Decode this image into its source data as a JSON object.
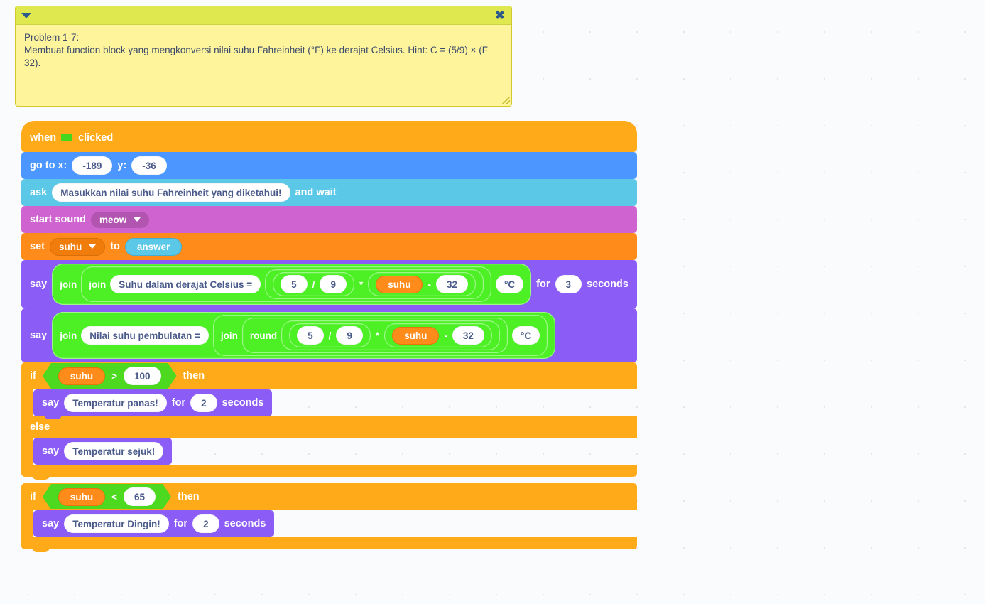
{
  "comment": {
    "collapse_icon": "triangle-down-icon",
    "close_icon": "close-icon",
    "text": "Problem 1-7:\nMembuat function block yang mengkonversi nilai suhu Fahreinheit (°F) ke derajat Celsius. Hint: C = (5/9) × (F − 32)."
  },
  "colors": {
    "events": "#ffab19",
    "motion": "#4c97ff",
    "sensing": "#5cc8e8",
    "sound": "#cf63cf",
    "variables": "#ff8c1a",
    "looks": "#8b5cf6",
    "control": "#ffab19",
    "operators": "#4cf024",
    "boolean": "#4cd91f",
    "comment_body": "#fef49c",
    "comment_bar": "#dfe84f",
    "canvas": "#fafbfc"
  },
  "script": {
    "hat": {
      "when": "when",
      "flag": "green-flag-icon",
      "clicked": "clicked"
    },
    "goto": {
      "label": "go to x:",
      "x": "-189",
      "y_label": "y:",
      "y": "-36"
    },
    "ask": {
      "label": "ask",
      "question": "Masukkan nilai suhu Fahreinheit yang diketahui!",
      "and_wait": "and wait"
    },
    "sound": {
      "label": "start sound",
      "value": "meow"
    },
    "set_var": {
      "label": "set",
      "variable": "suhu",
      "to": "to",
      "value": "answer"
    },
    "say1": {
      "label": "say",
      "join_outer": "join",
      "join_inner": "join",
      "text": "Suhu dalam derajat Celsius =",
      "num5": "5",
      "div": "/",
      "num9": "9",
      "mul": "*",
      "variable": "suhu",
      "minus": "-",
      "num32": "32",
      "unit": "°C",
      "for": "for",
      "seconds_value": "3",
      "seconds": "seconds"
    },
    "say2": {
      "label": "say",
      "join_outer": "join",
      "text": "Nilai suhu pembulatan =",
      "join_inner": "join",
      "round": "round",
      "num5": "5",
      "div": "/",
      "num9": "9",
      "mul": "*",
      "variable": "suhu",
      "minus": "-",
      "num32": "32",
      "unit": "°C"
    },
    "if1": {
      "if": "if",
      "variable": "suhu",
      "operator": ">",
      "value": "100",
      "then": "then",
      "say_label": "say",
      "say_text": "Temperatur panas!",
      "for": "for",
      "seconds_value": "2",
      "seconds": "seconds",
      "else": "else",
      "else_say_label": "say",
      "else_say_text": "Temperatur sejuk!"
    },
    "if2": {
      "if": "if",
      "variable": "suhu",
      "operator": "<",
      "value": "65",
      "then": "then",
      "say_label": "say",
      "say_text": "Temperatur Dingin!",
      "for": "for",
      "seconds_value": "2",
      "seconds": "seconds"
    }
  }
}
